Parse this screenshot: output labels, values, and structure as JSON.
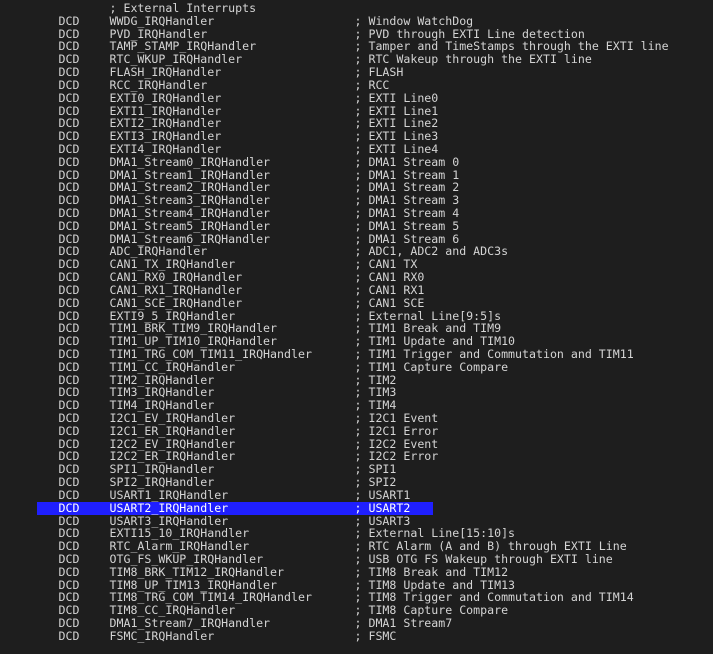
{
  "editor": {
    "background_color": "#1e1e1e",
    "text_color": "#d4d4d4",
    "selection_color": "#1f1fff",
    "selection_text_color": "#ffffff",
    "selected_line_index": 39,
    "font_family_kind": "monospace",
    "language": "ARM assembly (vector table)"
  },
  "lines": [
    {
      "directive": "",
      "symbol": "; External Interrupts",
      "comment": ""
    },
    {
      "directive": "DCD",
      "symbol": "WWDG_IRQHandler",
      "comment": "; Window WatchDog"
    },
    {
      "directive": "DCD",
      "symbol": "PVD_IRQHandler",
      "comment": "; PVD through EXTI Line detection"
    },
    {
      "directive": "DCD",
      "symbol": "TAMP_STAMP_IRQHandler",
      "comment": "; Tamper and TimeStamps through the EXTI line"
    },
    {
      "directive": "DCD",
      "symbol": "RTC_WKUP_IRQHandler",
      "comment": "; RTC Wakeup through the EXTI line"
    },
    {
      "directive": "DCD",
      "symbol": "FLASH_IRQHandler",
      "comment": "; FLASH"
    },
    {
      "directive": "DCD",
      "symbol": "RCC_IRQHandler",
      "comment": "; RCC"
    },
    {
      "directive": "DCD",
      "symbol": "EXTI0_IRQHandler",
      "comment": "; EXTI Line0"
    },
    {
      "directive": "DCD",
      "symbol": "EXTI1_IRQHandler",
      "comment": "; EXTI Line1"
    },
    {
      "directive": "DCD",
      "symbol": "EXTI2_IRQHandler",
      "comment": "; EXTI Line2"
    },
    {
      "directive": "DCD",
      "symbol": "EXTI3_IRQHandler",
      "comment": "; EXTI Line3"
    },
    {
      "directive": "DCD",
      "symbol": "EXTI4_IRQHandler",
      "comment": "; EXTI Line4"
    },
    {
      "directive": "DCD",
      "symbol": "DMA1_Stream0_IRQHandler",
      "comment": "; DMA1 Stream 0"
    },
    {
      "directive": "DCD",
      "symbol": "DMA1_Stream1_IRQHandler",
      "comment": "; DMA1 Stream 1"
    },
    {
      "directive": "DCD",
      "symbol": "DMA1_Stream2_IRQHandler",
      "comment": "; DMA1 Stream 2"
    },
    {
      "directive": "DCD",
      "symbol": "DMA1_Stream3_IRQHandler",
      "comment": "; DMA1 Stream 3"
    },
    {
      "directive": "DCD",
      "symbol": "DMA1_Stream4_IRQHandler",
      "comment": "; DMA1 Stream 4"
    },
    {
      "directive": "DCD",
      "symbol": "DMA1_Stream5_IRQHandler",
      "comment": "; DMA1 Stream 5"
    },
    {
      "directive": "DCD",
      "symbol": "DMA1_Stream6_IRQHandler",
      "comment": "; DMA1 Stream 6"
    },
    {
      "directive": "DCD",
      "symbol": "ADC_IRQHandler",
      "comment": "; ADC1, ADC2 and ADC3s"
    },
    {
      "directive": "DCD",
      "symbol": "CAN1_TX_IRQHandler",
      "comment": "; CAN1 TX"
    },
    {
      "directive": "DCD",
      "symbol": "CAN1_RX0_IRQHandler",
      "comment": "; CAN1 RX0"
    },
    {
      "directive": "DCD",
      "symbol": "CAN1_RX1_IRQHandler",
      "comment": "; CAN1 RX1"
    },
    {
      "directive": "DCD",
      "symbol": "CAN1_SCE_IRQHandler",
      "comment": "; CAN1 SCE"
    },
    {
      "directive": "DCD",
      "symbol": "EXTI9_5_IRQHandler",
      "comment": "; External Line[9:5]s"
    },
    {
      "directive": "DCD",
      "symbol": "TIM1_BRK_TIM9_IRQHandler",
      "comment": "; TIM1 Break and TIM9"
    },
    {
      "directive": "DCD",
      "symbol": "TIM1_UP_TIM10_IRQHandler",
      "comment": "; TIM1 Update and TIM10"
    },
    {
      "directive": "DCD",
      "symbol": "TIM1_TRG_COM_TIM11_IRQHandler",
      "comment": "; TIM1 Trigger and Commutation and TIM11"
    },
    {
      "directive": "DCD",
      "symbol": "TIM1_CC_IRQHandler",
      "comment": "; TIM1 Capture Compare"
    },
    {
      "directive": "DCD",
      "symbol": "TIM2_IRQHandler",
      "comment": "; TIM2"
    },
    {
      "directive": "DCD",
      "symbol": "TIM3_IRQHandler",
      "comment": "; TIM3"
    },
    {
      "directive": "DCD",
      "symbol": "TIM4_IRQHandler",
      "comment": "; TIM4"
    },
    {
      "directive": "DCD",
      "symbol": "I2C1_EV_IRQHandler",
      "comment": "; I2C1 Event"
    },
    {
      "directive": "DCD",
      "symbol": "I2C1_ER_IRQHandler",
      "comment": "; I2C1 Error"
    },
    {
      "directive": "DCD",
      "symbol": "I2C2_EV_IRQHandler",
      "comment": "; I2C2 Event"
    },
    {
      "directive": "DCD",
      "symbol": "I2C2_ER_IRQHandler",
      "comment": "; I2C2 Error"
    },
    {
      "directive": "DCD",
      "symbol": "SPI1_IRQHandler",
      "comment": "; SPI1"
    },
    {
      "directive": "DCD",
      "symbol": "SPI2_IRQHandler",
      "comment": "; SPI2"
    },
    {
      "directive": "DCD",
      "symbol": "USART1_IRQHandler",
      "comment": "; USART1"
    },
    {
      "directive": "DCD",
      "symbol": "USART2_IRQHandler",
      "comment": "; USART2"
    },
    {
      "directive": "DCD",
      "symbol": "USART3_IRQHandler",
      "comment": "; USART3"
    },
    {
      "directive": "DCD",
      "symbol": "EXTI15_10_IRQHandler",
      "comment": "; External Line[15:10]s"
    },
    {
      "directive": "DCD",
      "symbol": "RTC_Alarm_IRQHandler",
      "comment": "; RTC Alarm (A and B) through EXTI Line"
    },
    {
      "directive": "DCD",
      "symbol": "OTG_FS_WKUP_IRQHandler",
      "comment": "; USB OTG FS Wakeup through EXTI line"
    },
    {
      "directive": "DCD",
      "symbol": "TIM8_BRK_TIM12_IRQHandler",
      "comment": "; TIM8 Break and TIM12"
    },
    {
      "directive": "DCD",
      "symbol": "TIM8_UP_TIM13_IRQHandler",
      "comment": "; TIM8 Update and TIM13"
    },
    {
      "directive": "DCD",
      "symbol": "TIM8_TRG_COM_TIM14_IRQHandler",
      "comment": "; TIM8 Trigger and Commutation and TIM14"
    },
    {
      "directive": "DCD",
      "symbol": "TIM8_CC_IRQHandler",
      "comment": "; TIM8 Capture Compare"
    },
    {
      "directive": "DCD",
      "symbol": "DMA1_Stream7_IRQHandler",
      "comment": "; DMA1 Stream7"
    },
    {
      "directive": "DCD",
      "symbol": "FSMC_IRQHandler",
      "comment": "; FSMC"
    }
  ]
}
